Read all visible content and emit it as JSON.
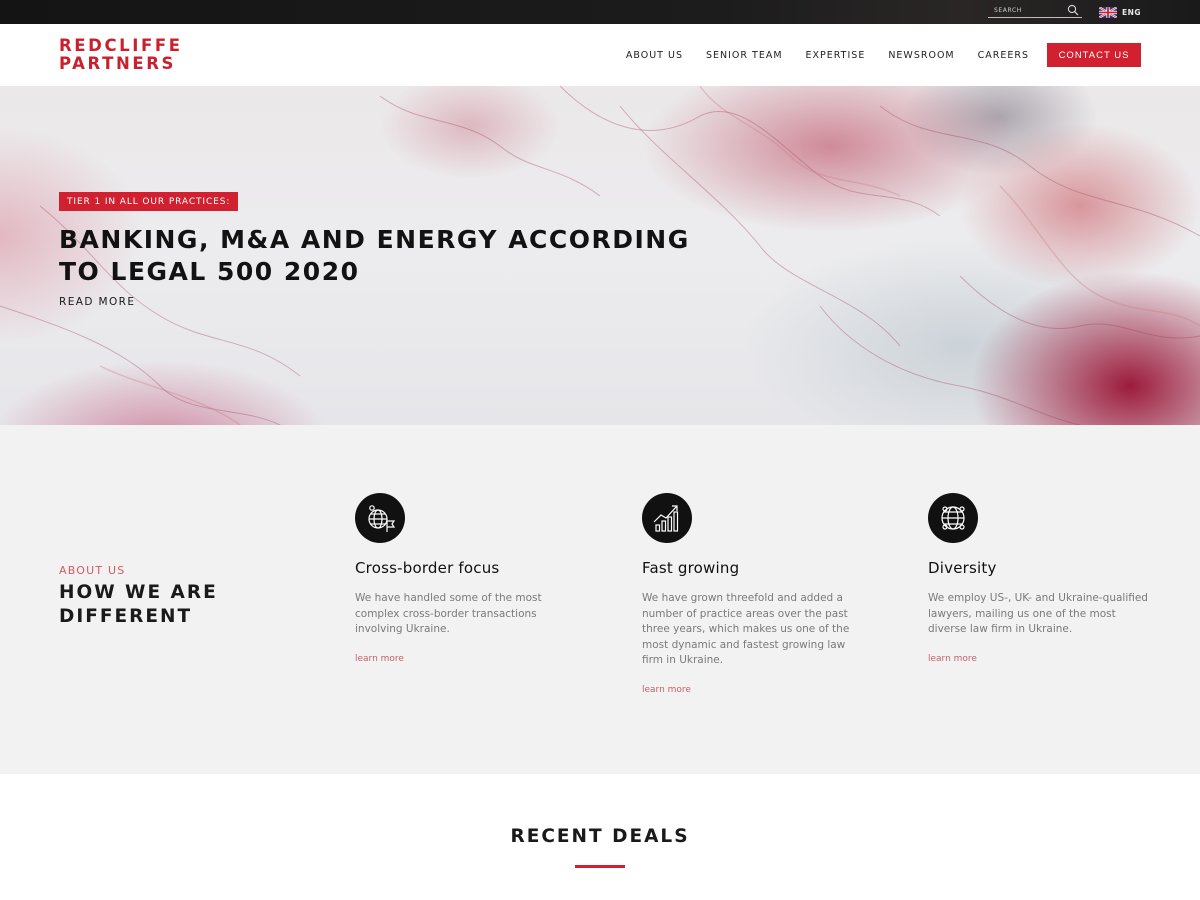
{
  "topbar": {
    "search_placeholder": "SEARCH",
    "search_icon": "search-icon",
    "language": "ENG",
    "flag_icon": "uk-flag-icon"
  },
  "header": {
    "logo_line1": "REDCLIFFE",
    "logo_line2": "PARTNERS",
    "nav": [
      "ABOUT US",
      "SENIOR TEAM",
      "EXPERTISE",
      "NEWSROOM",
      "CAREERS"
    ],
    "contact_label": "CONTACT US"
  },
  "hero": {
    "badge": "TIER 1 IN ALL OUR PRACTICES:",
    "title_line1": "BANKING, M&A AND ENERGY ACCORDING",
    "title_line2": "TO LEGAL 500 2020",
    "read_more": "READ MORE"
  },
  "about": {
    "kicker": "ABOUT US",
    "title_line1": "HOW WE ARE",
    "title_line2": "DIFFERENT",
    "features": [
      {
        "icon": "globe-flag-icon",
        "title": "Cross-border focus",
        "text": "We have handled some of the most complex cross-border transactions involving Ukraine.",
        "link": "learn more"
      },
      {
        "icon": "growth-chart-icon",
        "title": "Fast growing",
        "text": "We have grown threefold and added a number of practice areas over the past three years, which makes us one of the most dynamic and fastest growing law firm in Ukraine.",
        "link": "learn more"
      },
      {
        "icon": "diversity-globe-icon",
        "title": "Diversity",
        "text": "We employ US-, UK- and Ukraine-qualified lawyers, mailing us one of the most diverse law firm in Ukraine.",
        "link": "learn more"
      }
    ]
  },
  "deals": {
    "title": "RECENT DEALS"
  },
  "colors": {
    "brand_red": "#d1202f",
    "accent_pink": "#d35a62",
    "dark": "#111111",
    "section_gray": "#f2f2f2"
  }
}
